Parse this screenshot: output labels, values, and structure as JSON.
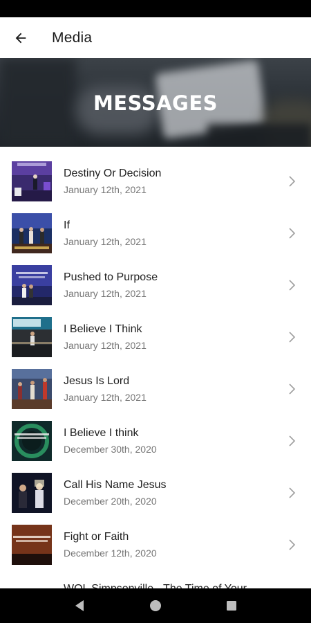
{
  "app_bar": {
    "title": "Media"
  },
  "banner": {
    "title": "MESSAGES"
  },
  "messages": [
    {
      "title": "Destiny Or Decision",
      "date": "January 12th, 2021"
    },
    {
      "title": "If",
      "date": "January 12th, 2021"
    },
    {
      "title": "Pushed to Purpose",
      "date": "January 12th, 2021"
    },
    {
      "title": "I Believe I Think",
      "date": "January 12th, 2021"
    },
    {
      "title": "Jesus Is Lord",
      "date": "January 12th, 2021"
    },
    {
      "title": "I Believe I think",
      "date": "December 30th, 2020"
    },
    {
      "title": "Call His Name Jesus",
      "date": "December 20th, 2020"
    },
    {
      "title": "Fight or Faith",
      "date": "December 12th, 2020"
    },
    {
      "title": "WOL Simpsonville - The Time of Your",
      "date": ""
    }
  ],
  "icons": {
    "back": "arrow-back-icon",
    "chevron": "chevron-right-icon",
    "nav_back": "triangle-back-icon",
    "nav_home": "circle-home-icon",
    "nav_recents": "square-recents-icon"
  },
  "colors": {
    "app_bar_bg": "#ffffff",
    "title_text": "#212121",
    "date_text": "#757575",
    "system_bars": "#000000"
  }
}
